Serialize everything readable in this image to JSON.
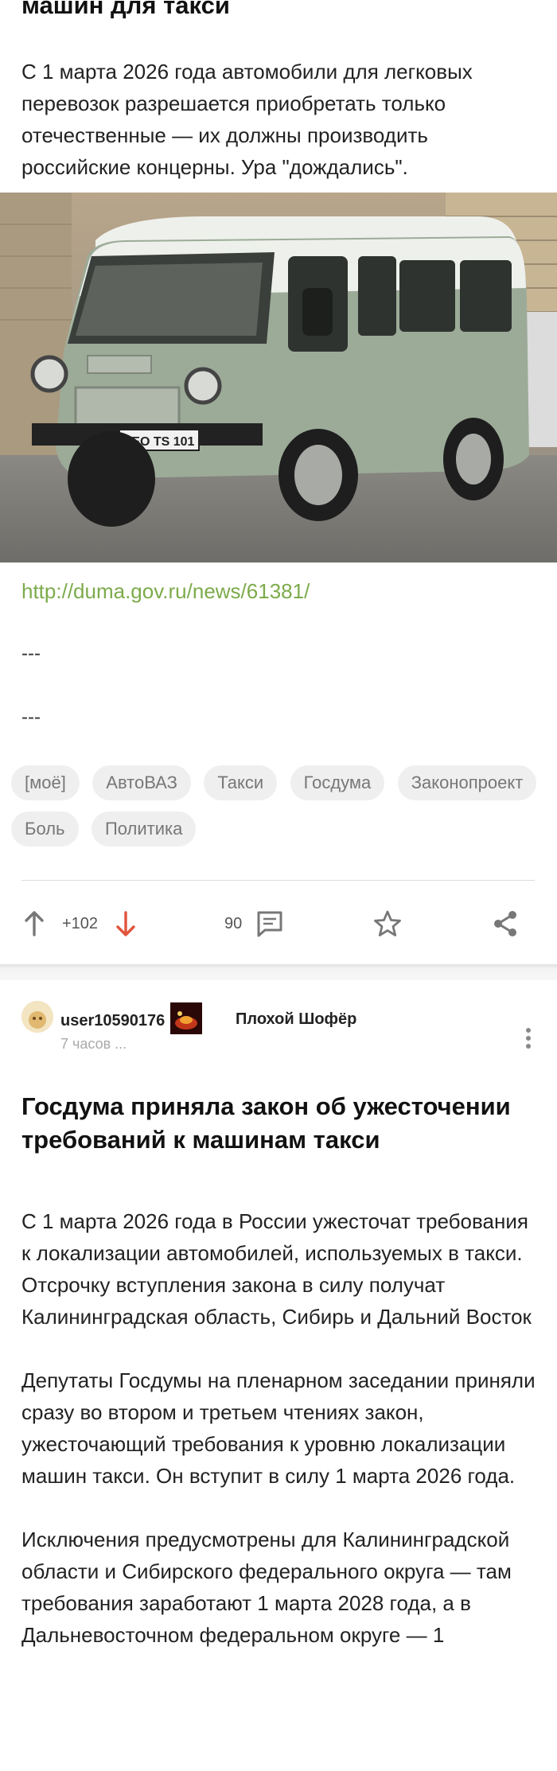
{
  "post1": {
    "title": "машин для такси",
    "text": "С 1 марта 2026 года автомобили для легковых перевозок разрешается приобретать только отечественные — их должны производить российские концерны. Ура \"дождались\".",
    "image_plate": "LEO TS 101",
    "link": "http://duma.gov.ru/news/61381/",
    "separator1": "---",
    "separator2": "---",
    "tags": [
      "[моё]",
      "АвтоВАЗ",
      "Такси",
      "Госдума",
      "Законопроект",
      "Боль",
      "Политика"
    ],
    "score": "+102",
    "comments": "90",
    "icons": {
      "upvote": "arrow-up-icon",
      "downvote": "arrow-down-icon",
      "comment": "comment-icon",
      "save": "star-icon",
      "share": "share-icon"
    }
  },
  "post2": {
    "author": "user10590176",
    "time": "7 часов ...",
    "community": "Плохой Шофёр",
    "title": "Госдума приняла закон об ужесточении требований к машинам такси",
    "paragraphs": [
      "С 1 марта 2026 года в России ужесточат требования к локализации автомобилей, используемых в такси. Отсрочку вступления закона в силу получат Калининградская область, Сибирь и Дальний Восток",
      "Депутаты Госдумы на пленарном заседании приняли сразу во втором и третьем чтениях закон, ужесточающий требования к уровню локализации машин такси. Он вступит в силу 1 марта 2026 года.",
      "Исключения предусмотрены для Калининградской области и Сибирского федерального округа — там требования заработают 1 марта 2028 года, а в Дальневосточном федеральном округе — 1"
    ]
  },
  "colors": {
    "link": "#7cab4b",
    "downvote": "#e0543c",
    "tag_bg": "#efefef"
  }
}
